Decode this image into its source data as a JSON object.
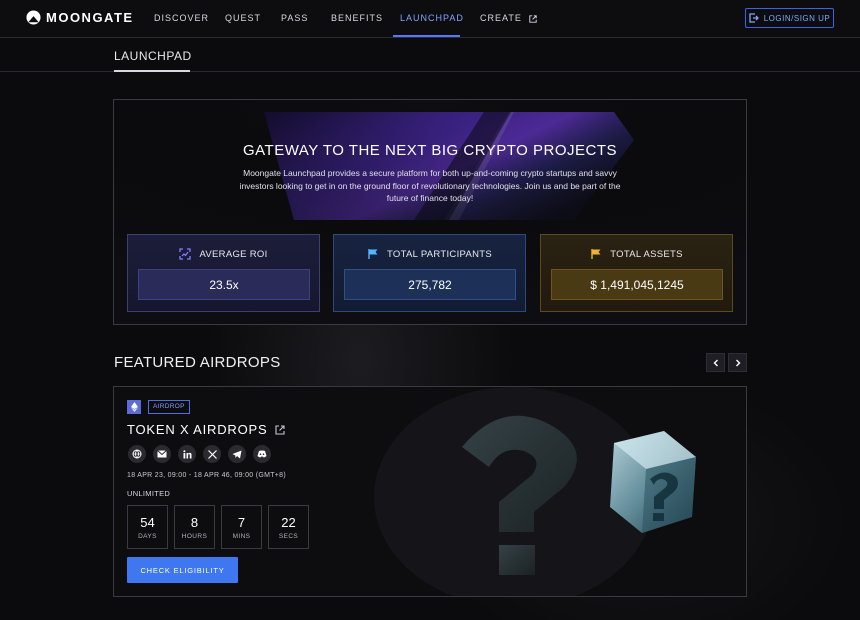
{
  "nav": {
    "logo": "MOONGATE",
    "items": [
      {
        "label": "DISCOVER"
      },
      {
        "label": "QUEST"
      },
      {
        "label": "PASS"
      },
      {
        "label": "BENEFITS"
      },
      {
        "label": "LAUNCHPAD"
      },
      {
        "label": "CREATE"
      }
    ],
    "active": "LAUNCHPAD",
    "login_label": "LOGIN/SIGN UP"
  },
  "subheader": {
    "title": "LAUNCHPAD"
  },
  "hero": {
    "title": "GATEWAY TO THE NEXT BIG CRYPTO PROJECTS",
    "description": "Moongate Launchpad provides a secure platform for both up-and-coming crypto startups and savvy investors looking to get in on the ground floor of revolutionary technologies. Join us and be part of the future of finance today!",
    "stats": [
      {
        "label": "AVERAGE ROI",
        "value": "23.5x",
        "icon": "scan-icon",
        "color": "#8a7cff"
      },
      {
        "label": "TOTAL PARTICIPANTS",
        "value": "275,782",
        "icon": "flag-icon",
        "color": "#4fb8ff"
      },
      {
        "label": "TOTAL ASSETS",
        "value": "$ 1,491,045,1245",
        "icon": "flag-icon",
        "color": "#f0b232"
      }
    ]
  },
  "featured": {
    "title": "FEATURED AIRDROPS",
    "card": {
      "chain_icon": "ethereum-icon",
      "tag": "AIRDROP",
      "title": "TOKEN X AIRDROPS",
      "socials": [
        "globe-icon",
        "mail-icon",
        "linkedin-icon",
        "x-icon",
        "telegram-icon",
        "discord-icon"
      ],
      "dates": "18 APR 23, 09:00 - 18 APR 46, 09:00 (GMT+8)",
      "limit": "UNLIMITED",
      "countdown": [
        {
          "value": "54",
          "unit": "DAYS"
        },
        {
          "value": "8",
          "unit": "HOURS"
        },
        {
          "value": "7",
          "unit": "MINS"
        },
        {
          "value": "22",
          "unit": "SECS"
        }
      ],
      "cta": "CHECK ELIGIBILITY"
    }
  },
  "colors": {
    "accent": "#4f7cff",
    "button": "#3f77f0",
    "background": "#0b0b0d"
  }
}
